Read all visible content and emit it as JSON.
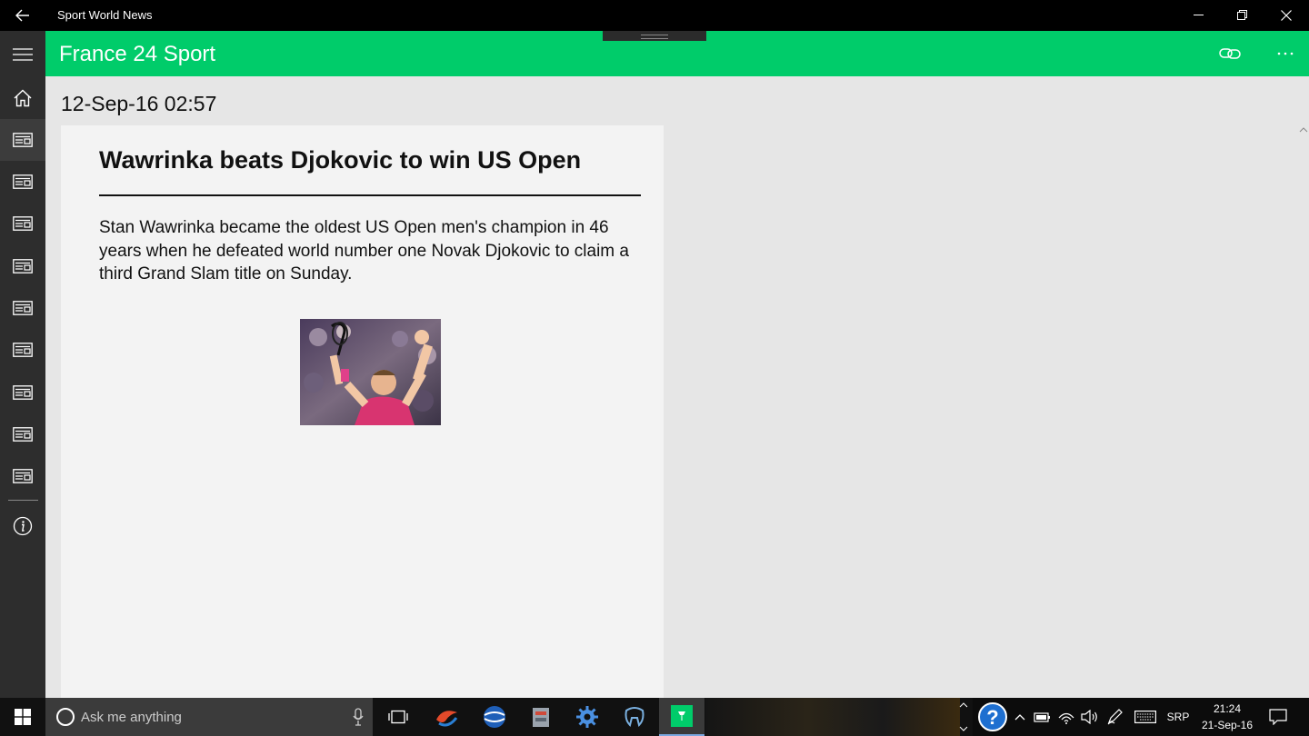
{
  "window": {
    "title": "Sport World News"
  },
  "header": {
    "title": "France 24 Sport"
  },
  "article": {
    "date": "12-Sep-16 02:57",
    "headline": "Wawrinka beats Djokovic to win US Open",
    "summary": "Stan Wawrinka became the oldest US Open men's champion in 46 years when he defeated world number one Novak Djokovic to claim a third Grand Slam title on Sunday."
  },
  "sidebar": {
    "items": [
      {
        "icon": "home-icon"
      },
      {
        "icon": "news-icon"
      },
      {
        "icon": "news-icon"
      },
      {
        "icon": "news-icon"
      },
      {
        "icon": "news-icon"
      },
      {
        "icon": "news-icon"
      },
      {
        "icon": "news-icon"
      },
      {
        "icon": "news-icon"
      },
      {
        "icon": "news-icon"
      },
      {
        "icon": "news-icon"
      },
      {
        "icon": "info-icon"
      }
    ]
  },
  "taskbar": {
    "search_placeholder": "Ask me anything",
    "language": "SRP",
    "time": "21:24",
    "date": "21-Sep-16"
  },
  "colors": {
    "accent": "#00cc6a",
    "sidebar": "#2d2d2d",
    "background": "#e6e6e6"
  }
}
